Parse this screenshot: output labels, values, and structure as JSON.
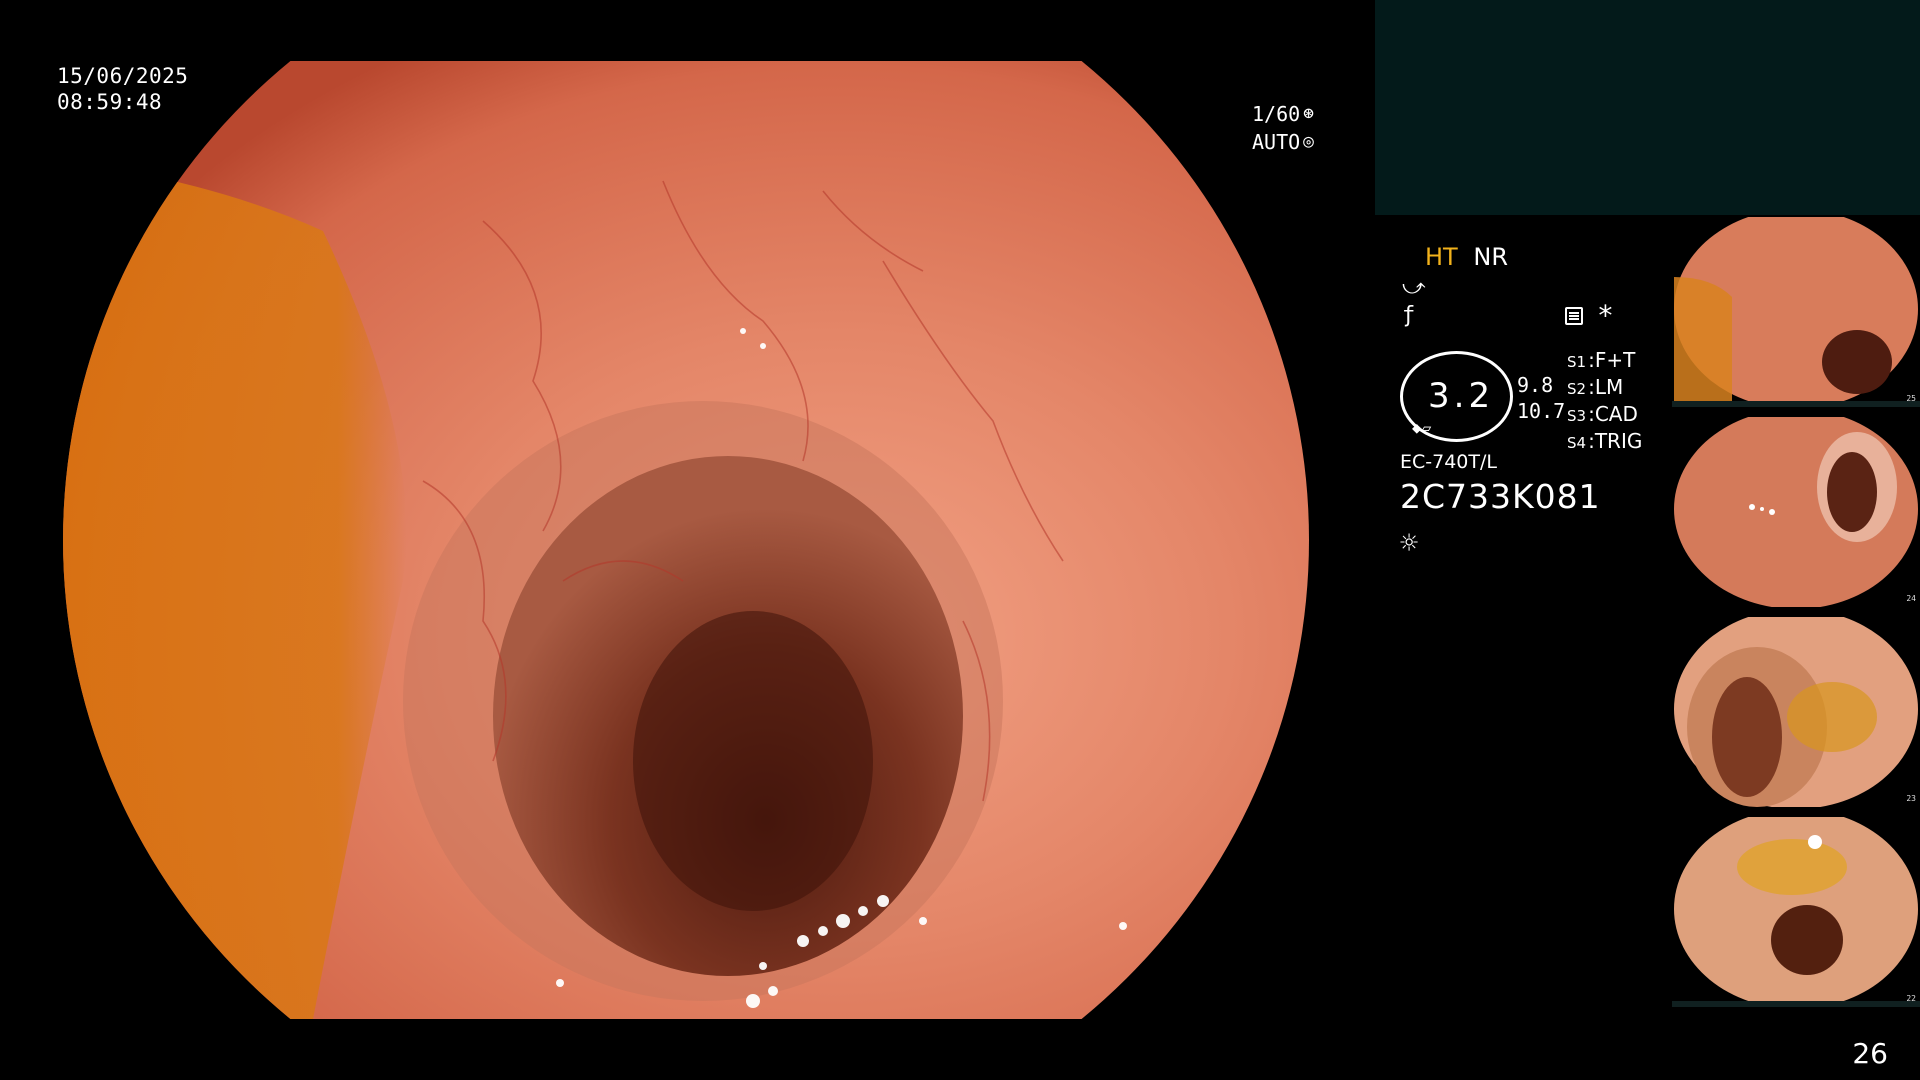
{
  "overlay": {
    "date": "15/06/2025",
    "time": "08:59:48",
    "shutter": "1/60",
    "iris": "AUTO"
  },
  "panel": {
    "mode_ht": "HT",
    "mode_nr": "NR",
    "zoom": "3.2",
    "zoom_sub_1": "9.8",
    "zoom_sub_2": "10.7",
    "switches": [
      {
        "key": "S1",
        "value": "F+T"
      },
      {
        "key": "S2",
        "value": "LM"
      },
      {
        "key": "S3",
        "value": "CAD"
      },
      {
        "key": "S4",
        "value": "TRIG"
      }
    ],
    "scope_model": "EC-740T/L",
    "scope_serial": "2C733K081"
  },
  "thumbnails": [
    {
      "index": "25"
    },
    {
      "index": "24"
    },
    {
      "index": "23"
    },
    {
      "index": "22"
    }
  ],
  "page_number": "26",
  "colors": {
    "accent_ht": "#f2b21b",
    "top_box": "#031a1a",
    "mucosa": "#e0765a"
  },
  "icons": [
    "shutter-icon",
    "iris-icon",
    "menu-icon",
    "asterisk-icon",
    "light-icon",
    "scope-angle-icon"
  ]
}
